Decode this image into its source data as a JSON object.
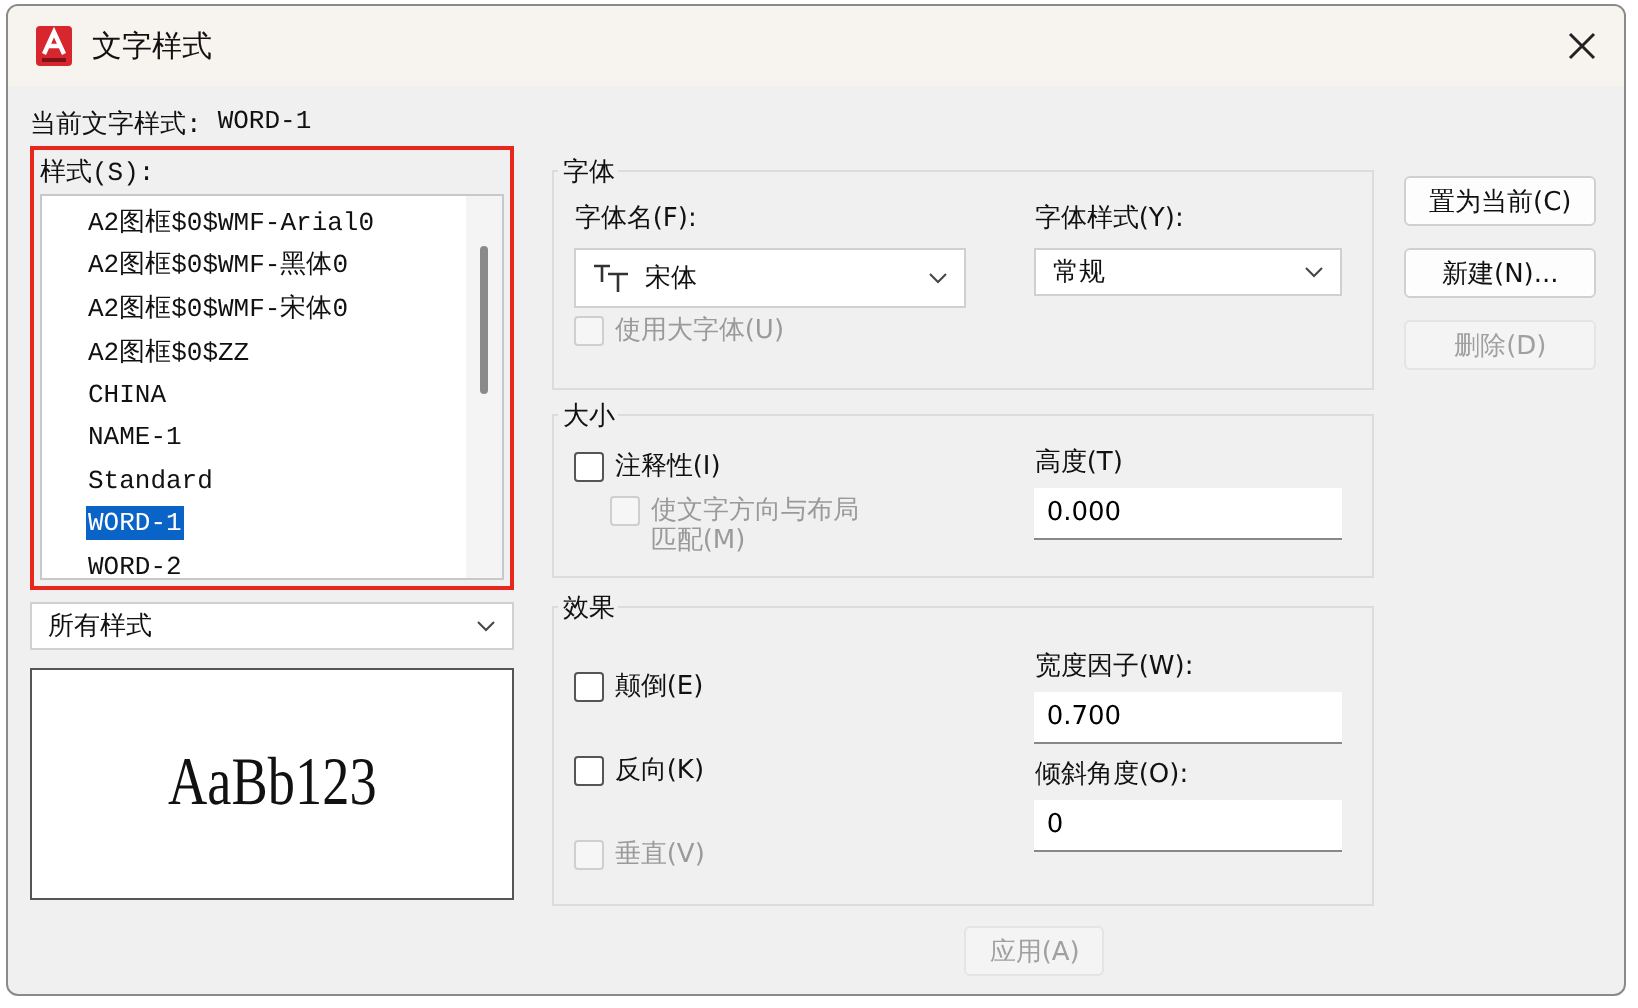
{
  "window": {
    "title": "文字样式"
  },
  "current_style": {
    "label": "当前文字样式:",
    "value": "WORD-1"
  },
  "styles": {
    "label": "样式(S):",
    "highlighted": true,
    "items": [
      {
        "label": "A2图框$0$WMF-Arial0",
        "selected": false
      },
      {
        "label": "A2图框$0$WMF-黑体0",
        "selected": false
      },
      {
        "label": "A2图框$0$WMF-宋体0",
        "selected": false
      },
      {
        "label": "A2图框$0$ZZ",
        "selected": false
      },
      {
        "label": "CHINA",
        "selected": false
      },
      {
        "label": "NAME-1",
        "selected": false
      },
      {
        "label": "Standard",
        "selected": false
      },
      {
        "label": "WORD-1",
        "selected": true
      },
      {
        "label": "WORD-2",
        "selected": false
      }
    ]
  },
  "filter": {
    "value": "所有样式"
  },
  "preview": {
    "text": "AaBb123"
  },
  "font": {
    "title": "字体",
    "font_name": {
      "label": "字体名(F):",
      "value": "宋体"
    },
    "font_style": {
      "label": "字体样式(Y):",
      "value": "常规"
    },
    "use_big_font": {
      "label": "使用大字体(U)",
      "checked": false,
      "disabled": true
    }
  },
  "size": {
    "title": "大小",
    "annotative": {
      "label": "注释性(I)",
      "checked": false,
      "disabled": false
    },
    "match_orientation": {
      "label": "使文字方向与布局匹配(M)",
      "checked": false,
      "disabled": true
    },
    "height": {
      "label": "高度(T)",
      "value": "0.000"
    }
  },
  "effects": {
    "title": "效果",
    "checkboxes": [
      {
        "label": "颠倒(E)",
        "checked": false,
        "disabled": false
      },
      {
        "label": "反向(K)",
        "checked": false,
        "disabled": false
      },
      {
        "label": "垂直(V)",
        "checked": false,
        "disabled": true
      }
    ],
    "width_factor": {
      "label": "宽度因子(W):",
      "value": "0.700"
    },
    "oblique_angle": {
      "label": "倾斜角度(O):",
      "value": "0"
    }
  },
  "side_buttons": [
    {
      "label": "置为当前(C)",
      "disabled": false
    },
    {
      "label": "新建(N)...",
      "disabled": false
    },
    {
      "label": "删除(D)",
      "disabled": true
    }
  ],
  "bottom_buttons": [
    {
      "label": "应用(A)",
      "disabled": true
    }
  ]
}
